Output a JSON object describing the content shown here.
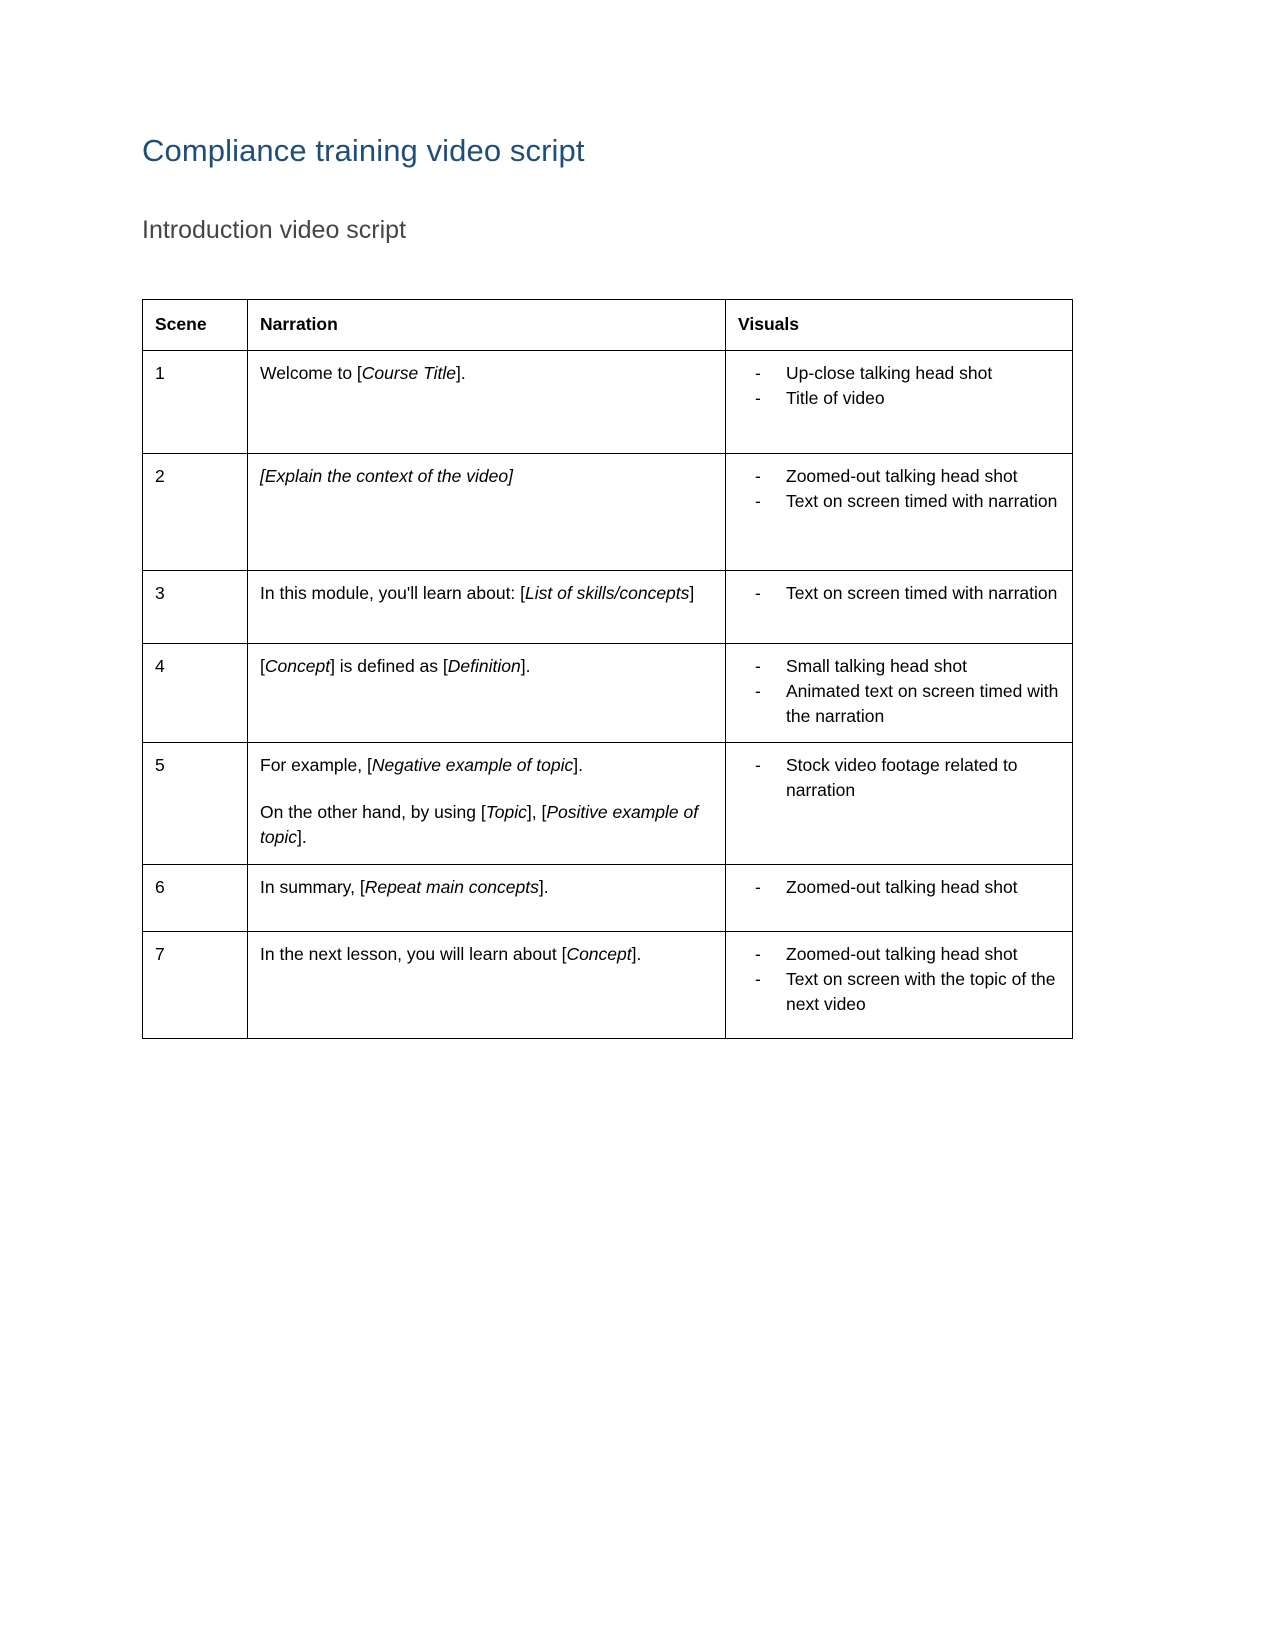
{
  "document": {
    "title": "Compliance training video script",
    "subtitle": "Introduction video script",
    "title_color": "#1f4e79",
    "subtitle_color": "#454545"
  },
  "table": {
    "headers": {
      "scene": "Scene",
      "narration": "Narration",
      "visuals": "Visuals"
    },
    "bullet_marker": "-",
    "rows": [
      {
        "scene": "1",
        "narration_parts": [
          [
            {
              "text": "Welcome to [",
              "italic": false
            },
            {
              "text": "Course Title",
              "italic": true
            },
            {
              "text": "].",
              "italic": false
            }
          ]
        ],
        "visuals": [
          "Up-close talking head shot",
          "Title of video"
        ]
      },
      {
        "scene": "2",
        "narration_parts": [
          [
            {
              "text": "[Explain the context of the video]",
              "italic": true
            }
          ]
        ],
        "visuals": [
          "Zoomed-out talking head shot",
          "Text on screen timed with narration"
        ]
      },
      {
        "scene": "3",
        "narration_parts": [
          [
            {
              "text": "In this module, you'll learn about: [",
              "italic": false
            },
            {
              "text": "List of skills/concepts",
              "italic": true
            },
            {
              "text": "]",
              "italic": false
            }
          ]
        ],
        "visuals": [
          "Text on screen timed with narration"
        ]
      },
      {
        "scene": "4",
        "narration_parts": [
          [
            {
              "text": "[",
              "italic": false
            },
            {
              "text": "Concept",
              "italic": true
            },
            {
              "text": "] is defined as [",
              "italic": false
            },
            {
              "text": "Definition",
              "italic": true
            },
            {
              "text": "].",
              "italic": false
            }
          ]
        ],
        "visuals": [
          "Small talking head shot",
          "Animated text on screen timed with the narration"
        ]
      },
      {
        "scene": "5",
        "narration_parts": [
          [
            {
              "text": "For example, [",
              "italic": false
            },
            {
              "text": "Negative example of topic",
              "italic": true
            },
            {
              "text": "].",
              "italic": false
            }
          ],
          [
            {
              "text": "On the other hand, by using [",
              "italic": false
            },
            {
              "text": "Topic",
              "italic": true
            },
            {
              "text": "], [",
              "italic": false
            },
            {
              "text": "Positive example of topic",
              "italic": true
            },
            {
              "text": "].",
              "italic": false
            }
          ]
        ],
        "visuals": [
          "Stock video footage related to narration"
        ]
      },
      {
        "scene": "6",
        "narration_parts": [
          [
            {
              "text": "In summary, [",
              "italic": false
            },
            {
              "text": "Repeat main concepts",
              "italic": true
            },
            {
              "text": "].",
              "italic": false
            }
          ]
        ],
        "visuals": [
          "Zoomed-out talking head shot"
        ]
      },
      {
        "scene": "7",
        "narration_parts": [
          [
            {
              "text": "In the next lesson, you will learn about [",
              "italic": false
            },
            {
              "text": "Concept",
              "italic": true
            },
            {
              "text": "].",
              "italic": false
            }
          ]
        ],
        "visuals": [
          "Zoomed-out talking head shot",
          "Text on screen with the topic of the next video"
        ]
      }
    ]
  }
}
